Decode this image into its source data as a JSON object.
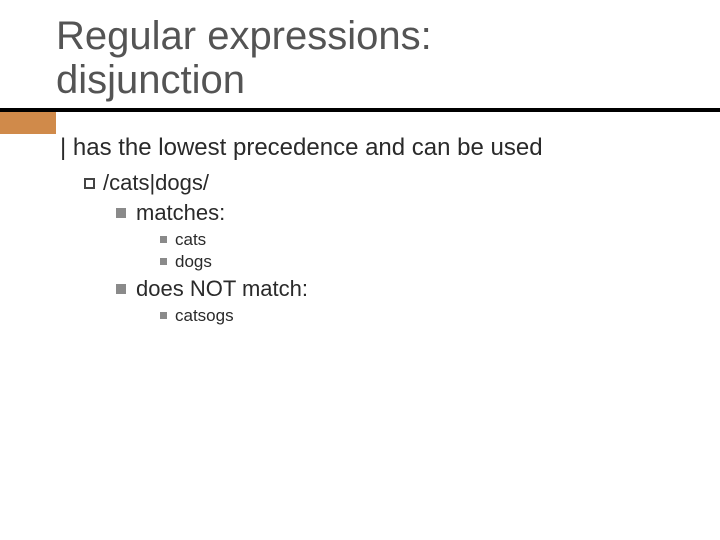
{
  "title": {
    "line1": "Regular expressions:",
    "line2": "disjunction"
  },
  "body": {
    "lvl1": "| has the lowest precedence and can be used",
    "lvl2": "/cats|dogs/",
    "matches_label": "matches:",
    "matches": {
      "item1": "cats",
      "item2": "dogs"
    },
    "notmatch_label": "does NOT match:",
    "notmatch": {
      "item1": "catsogs"
    }
  }
}
